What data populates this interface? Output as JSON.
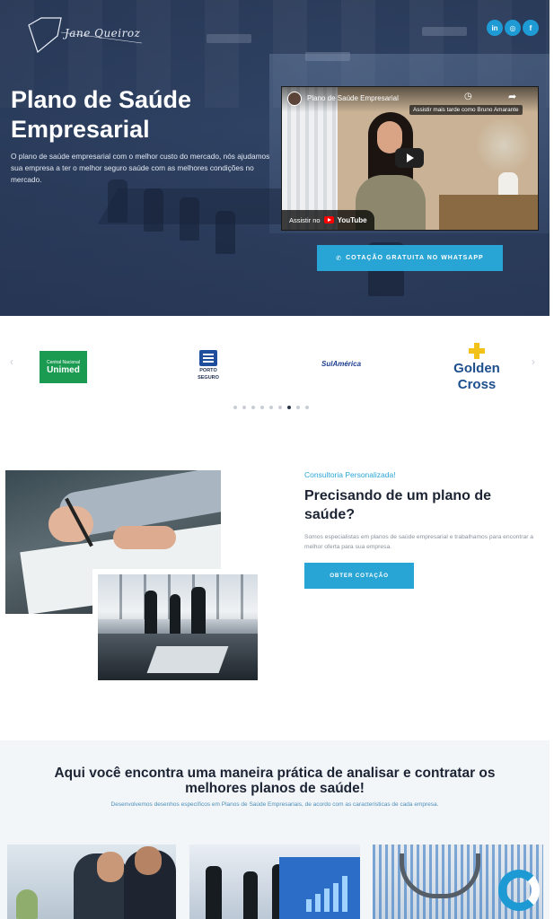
{
  "header": {
    "logo_text": "Jane Queiroz",
    "social": [
      {
        "label": "in",
        "icon": "linkedin-icon"
      },
      {
        "label": "◎",
        "icon": "instagram-icon"
      },
      {
        "label": "f",
        "icon": "facebook-icon"
      }
    ]
  },
  "hero": {
    "title": "Plano de Saúde Empresarial",
    "text": "O plano de saúde empresarial com o melhor custo do mercado, nós ajudamos sua empresa a ter o melhor seguro saúde com as melhores condições no mercado.",
    "video": {
      "title": "Plano de Saúde Empresarial",
      "watch_later": "Assistir mais tarde como Bruno Amarante",
      "watch_on": "Assistir no",
      "platform": "YouTube"
    },
    "cta_label": "COTAÇÃO GRATUITA NO WHATSAPP",
    "cta_icon": "whatsapp-icon"
  },
  "partners": {
    "logos": [
      {
        "name": "Unimed",
        "line1": "Central Nacional",
        "line2": "Unimed"
      },
      {
        "name": "Porto Seguro",
        "line1": "PORTO",
        "line2": "SEGURO"
      },
      {
        "name": "SulAmérica",
        "line1": "SulAmérica"
      },
      {
        "name": "Golden Cross",
        "line1": "Golden",
        "line2": "Cross"
      }
    ],
    "dots_total": 9,
    "dots_active": 7
  },
  "consult": {
    "eyebrow": "Consultoria Personalizada!",
    "title": "Precisando de um plano de saúde?",
    "text": "Somos especialistas em planos de saúde empresarial e trabalhamos para encontrar a melhor oferta para sua empresa.",
    "button": "OBTER COTAÇÃO"
  },
  "bottom": {
    "title": "Aqui você encontra uma maneira prática de analisar e contratar os melhores planos de saúde!",
    "subtitle": "Desenvolvemos desenhos específicos em Planos de Saúde Empresariais, de acordo com as caracteristicas de cada empresa."
  },
  "colors": {
    "accent": "#29a5d5",
    "hero_bg": "#2d3f5e",
    "heading": "#1c2434",
    "section_bg": "#f3f6f9"
  }
}
